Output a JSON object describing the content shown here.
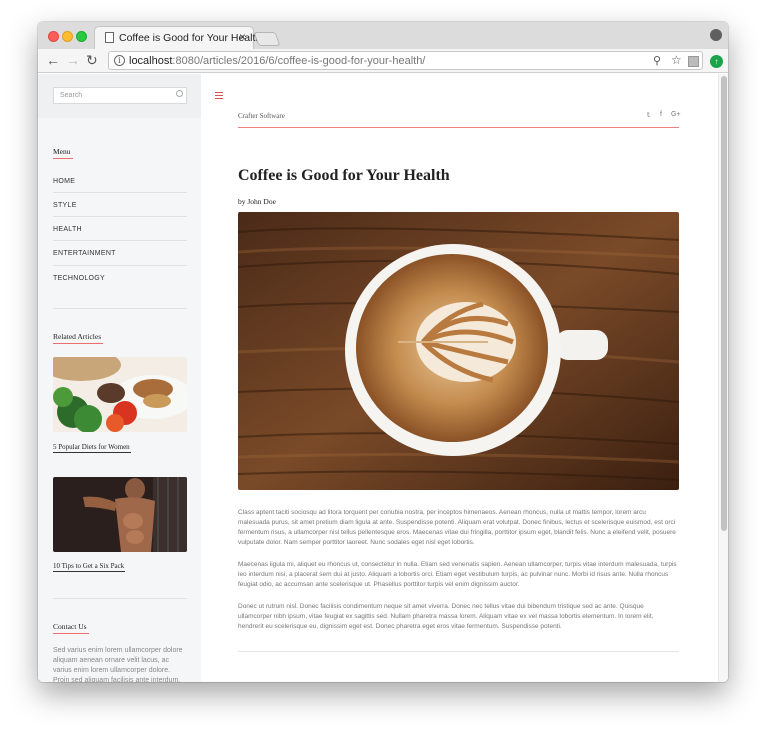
{
  "browser": {
    "tab_title": "Coffee is Good for Your Health",
    "tab_close": "×",
    "url_host": "localhost",
    "url_rest": ":8080/articles/2016/6/coffee-is-good-for-your-health/",
    "back": "←",
    "forward": "→",
    "reload": "↻",
    "info": "i",
    "zoom": "⚲",
    "star": "☆"
  },
  "sidebar": {
    "search_placeholder": "Search",
    "menu_title": "Menu",
    "menu_items": [
      "HOME",
      "STYLE",
      "HEALTH",
      "ENTERTAINMENT",
      "TECHNOLOGY"
    ],
    "related_title": "Related Articles",
    "related": [
      {
        "title": "5 Popular Diets for Women"
      },
      {
        "title": "10 Tips to Get a Six Pack"
      }
    ],
    "contact_title": "Contact Us",
    "contact_text": "Sed varius enim lorem ullamcorper dolore aliquam aenean ornare velit lacus, ac varius enim lorem ullamcorper dolore. Proin sed aliquam facilisis ante interdum. Sed nulla"
  },
  "header": {
    "brand": "Crafter Software",
    "social": [
      "twitter",
      "facebook",
      "google-plus"
    ],
    "social_glyphs": [
      "𝕥",
      "f",
      "G+"
    ]
  },
  "article": {
    "title": "Coffee is Good for Your Health",
    "byline": "by John Doe",
    "paragraphs": [
      "Class aptent taciti sociosqu ad litora torquent per conubia nostra, per inceptos himenaeos. Aenean rhoncus, nulla ut mattis tempor, lorem arcu malesuada purus, sit amet pretium diam ligula at ante. Suspendisse potenti. Aliquam erat volutpat. Donec finibus, lectus et scelerisque euismod, est orci fermentum risus, a ullamcorper nisl tellus pellentesque eros. Maecenas vitae dui fringilla, porttitor ipsum eget, blandit felis. Nunc a eleifend velit, posuere vulputate dolor. Nam semper porttitor laoreet. Nunc sodales eget nisl eget lobortis.",
      "Maecenas ligula mi, aliquet eu rhoncus ut, consectetur in nulla. Etiam sed venenatis sapien. Aenean ullamcorper, turpis vitae interdum malesuada, turpis leo interdum nisi, a placerat sem dui at justo. Aliquam a lobortis orci. Etiam eget vestibulum turpis, ac pulvinar nunc. Morbi id risus ante. Nulla rhoncus feugiat odio, ac accumsan ante scelerisque ut. Phasellus porttitor turpis vel enim dignissim auctor.",
      "Donec ut rutrum nisl. Donec facilisis condimentum neque sit amet viverra. Donec nec tellus vitae dui bibendum tristique sed ac ante. Quisque ullamcorper nibh ipsum, vitae feugiat ex sagittis sed. Nullam pharetra massa lorem. Aliquam vitae ex vel massa lobortis elementum. In lorem elit, hendrerit eu scelerisque eu, dignissim eget est. Donec pharetra eget eros vitae fermentum. Suspendisse potenti."
    ]
  },
  "colors": {
    "accent": "#e04f4f",
    "sidebar_bg": "#f5f6f7"
  }
}
